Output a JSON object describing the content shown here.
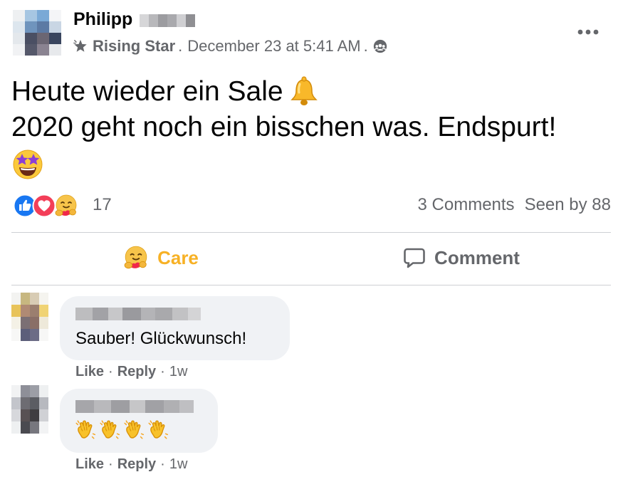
{
  "post": {
    "author_name": "Philipp",
    "badge": "Rising Star",
    "timestamp": "December 23 at 5:41 AM",
    "separator": ".",
    "privacy_icon": "group-icon",
    "more_icon": "more-horizontal-icon",
    "text_line1": "Heute wieder ein Sale",
    "text_line2": "2020 geht noch ein bisschen was. Endspurt!",
    "emoji_bell": "bell-emoji",
    "emoji_star_struck": "star-struck-emoji"
  },
  "reactions": {
    "icons": [
      "like-reaction-icon",
      "love-reaction-icon",
      "care-reaction-icon"
    ],
    "count": "17",
    "comments": "3 Comments",
    "seen_by": "Seen by 88"
  },
  "actions": {
    "care_label": "Care",
    "comment_label": "Comment"
  },
  "comments": [
    {
      "text": "Sauber! Glückwunsch!",
      "like": "Like",
      "reply": "Reply",
      "time": "1w",
      "dot": "·"
    },
    {
      "emojis": [
        "clapping-hands-emoji",
        "clapping-hands-emoji",
        "clapping-hands-emoji",
        "clapping-hands-emoji"
      ],
      "like": "Like",
      "reply": "Reply",
      "time": "1w",
      "dot": "·"
    }
  ],
  "colors": {
    "text_primary": "#050505",
    "text_secondary": "#65676b",
    "care_accent": "#f7b125",
    "bubble_bg": "#f0f2f5",
    "divider": "#ced0d4",
    "like_blue": "#1877f2",
    "love_red": "#f33e58"
  }
}
